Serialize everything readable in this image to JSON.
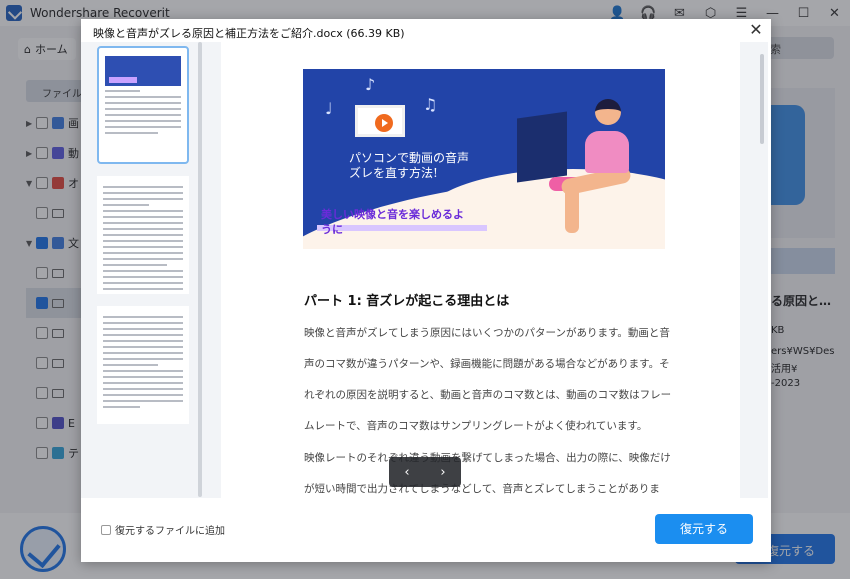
{
  "app": {
    "title": "Wondershare Recoverit",
    "home_label": "ホーム",
    "filetype_tab": "ファイルの",
    "search_stub": "索",
    "right_panel": {
      "title": "る原因と…",
      "size": "KB",
      "path_line1": "ers¥WS¥Deskto",
      "path_line2": "活用¥",
      "date": "-2023"
    },
    "bg_restore_label": "復元する",
    "titlebar_icons": [
      "user-icon",
      "headset-icon",
      "mail-icon",
      "settings-icon",
      "menu-icon",
      "minimize-icon",
      "maximize-icon",
      "close-icon"
    ],
    "tree_labels": [
      "画",
      "動",
      "オ",
      "",
      "文",
      "",
      "",
      "",
      "",
      "",
      "E",
      "テ"
    ]
  },
  "modal": {
    "title": "映像と音声がズレる原因と補正方法をご紹介.docx (66.39 KB)",
    "banner": {
      "heading": "パソコンで動画の音声ズレを直す方法!",
      "subheading": "美しい映像と音を楽しめるように"
    },
    "heading": "パート 1:  音ズレが起こる理由とは",
    "paragraphs": [
      "映像と音声がズレてしまう原因にはいくつかのパターンがあります。動画と音",
      "声のコマ数が違うパターンや、録画機能に問題がある場合などがあります。そ",
      "れぞれの原因を説明すると、動画と音声のコマ数とは、動画のコマ数はフレー",
      "ムレートで、音声のコマ数はサンプリングレートがよく使われています。",
      "映像レートのそれぞれ違う動画を繋げてしまった場合、出力の際に、映像だけ",
      "が短い時間で出力されてしまうなどして、音声とズレてしまうことがありま"
    ],
    "pager": {
      "prev": "‹",
      "next": "›"
    },
    "footer": {
      "add_to_restore_label": "復元するファイルに追加",
      "restore_label": "復元する"
    }
  },
  "colors": {
    "accent": "#1b8ef0",
    "banner_bg": "#2244a8",
    "banner_sub": "#6a2bd9"
  }
}
